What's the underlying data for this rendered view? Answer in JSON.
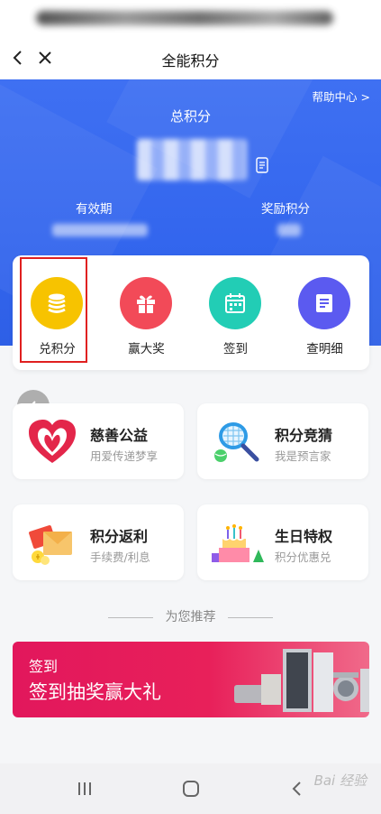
{
  "nav": {
    "title": "全能积分"
  },
  "hero": {
    "help_link": "帮助中心 >",
    "total_label": "总积分",
    "validity_label": "有效期",
    "reward_label": "奖励积分"
  },
  "quick_actions": [
    {
      "label": "兑积分",
      "icon": "coins-icon",
      "color": "#f7c300"
    },
    {
      "label": "赢大奖",
      "icon": "gift-icon",
      "color": "#f24a58"
    },
    {
      "label": "签到",
      "icon": "calendar-icon",
      "color": "#22cdb5"
    },
    {
      "label": "查明细",
      "icon": "list-icon",
      "color": "#5b5af0"
    }
  ],
  "services": [
    {
      "title": "慈善公益",
      "subtitle": "用爱传递梦享",
      "icon": "heart-icon"
    },
    {
      "title": "积分竞猜",
      "subtitle": "我是预言家",
      "icon": "tennis-racket-icon"
    },
    {
      "title": "积分返利",
      "subtitle": "手续费/利息",
      "icon": "red-envelope-icon"
    },
    {
      "title": "生日特权",
      "subtitle": "积分优惠兑",
      "icon": "birthday-cake-icon"
    }
  ],
  "recommend": {
    "title": "为您推荐"
  },
  "banner": {
    "tag": "签到",
    "title": "签到抽奖赢大礼"
  },
  "watermark": "Bai 经验",
  "colors": {
    "hero_blue": "#3366ee",
    "highlight_red": "#e02020",
    "banner_pink": "#e2175c"
  }
}
